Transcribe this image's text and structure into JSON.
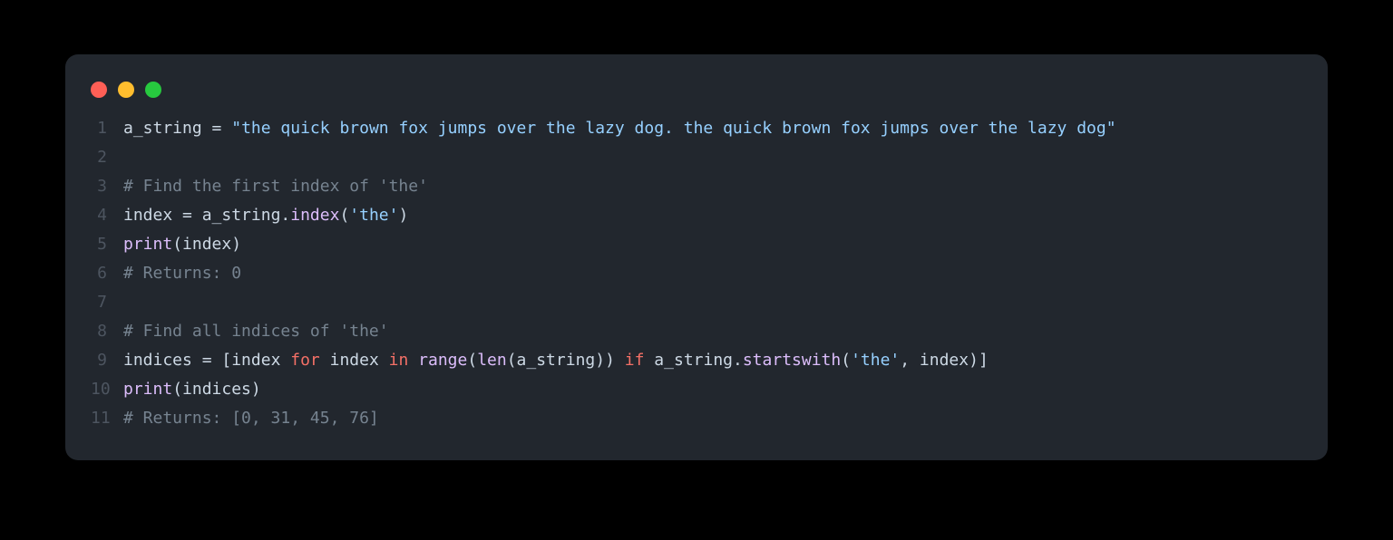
{
  "window": {
    "dots": [
      "red",
      "yellow",
      "green"
    ]
  },
  "code": {
    "lines": [
      {
        "n": "1",
        "tokens": [
          {
            "t": "a_string ",
            "c": "t-text"
          },
          {
            "t": "=",
            "c": "t-op"
          },
          {
            "t": " ",
            "c": "t-text"
          },
          {
            "t": "\"the quick brown fox jumps over the lazy dog. the quick brown fox jumps over the lazy dog\"",
            "c": "t-str"
          }
        ]
      },
      {
        "n": "2",
        "tokens": []
      },
      {
        "n": "3",
        "tokens": [
          {
            "t": "# Find the first index of 'the'",
            "c": "t-com"
          }
        ]
      },
      {
        "n": "4",
        "tokens": [
          {
            "t": "index ",
            "c": "t-text"
          },
          {
            "t": "=",
            "c": "t-op"
          },
          {
            "t": " a_string.",
            "c": "t-text"
          },
          {
            "t": "index",
            "c": "t-fn"
          },
          {
            "t": "(",
            "c": "t-paren"
          },
          {
            "t": "'the'",
            "c": "t-str"
          },
          {
            "t": ")",
            "c": "t-paren"
          }
        ]
      },
      {
        "n": "5",
        "tokens": [
          {
            "t": "print",
            "c": "t-fn"
          },
          {
            "t": "(",
            "c": "t-paren"
          },
          {
            "t": "index",
            "c": "t-text"
          },
          {
            "t": ")",
            "c": "t-paren"
          }
        ]
      },
      {
        "n": "6",
        "tokens": [
          {
            "t": "# Returns: 0",
            "c": "t-com"
          }
        ]
      },
      {
        "n": "7",
        "tokens": []
      },
      {
        "n": "8",
        "tokens": [
          {
            "t": "# Find all indices of 'the'",
            "c": "t-com"
          }
        ]
      },
      {
        "n": "9",
        "tokens": [
          {
            "t": "indices ",
            "c": "t-text"
          },
          {
            "t": "=",
            "c": "t-op"
          },
          {
            "t": " [index ",
            "c": "t-text"
          },
          {
            "t": "for",
            "c": "t-kw"
          },
          {
            "t": " index ",
            "c": "t-text"
          },
          {
            "t": "in",
            "c": "t-kw"
          },
          {
            "t": " ",
            "c": "t-text"
          },
          {
            "t": "range",
            "c": "t-fn"
          },
          {
            "t": "(",
            "c": "t-paren"
          },
          {
            "t": "len",
            "c": "t-fn"
          },
          {
            "t": "(",
            "c": "t-paren"
          },
          {
            "t": "a_string",
            "c": "t-text"
          },
          {
            "t": "))",
            "c": "t-paren"
          },
          {
            "t": " ",
            "c": "t-text"
          },
          {
            "t": "if",
            "c": "t-kw"
          },
          {
            "t": " a_string.",
            "c": "t-text"
          },
          {
            "t": "startswith",
            "c": "t-fn"
          },
          {
            "t": "(",
            "c": "t-paren"
          },
          {
            "t": "'the'",
            "c": "t-str"
          },
          {
            "t": ", index",
            "c": "t-text"
          },
          {
            "t": ")",
            "c": "t-paren"
          },
          {
            "t": "]",
            "c": "t-text"
          }
        ]
      },
      {
        "n": "10",
        "tokens": [
          {
            "t": "print",
            "c": "t-fn"
          },
          {
            "t": "(",
            "c": "t-paren"
          },
          {
            "t": "indices",
            "c": "t-text"
          },
          {
            "t": ")",
            "c": "t-paren"
          }
        ]
      },
      {
        "n": "11",
        "tokens": [
          {
            "t": "# Returns: [0, 31, 45, 76]",
            "c": "t-com"
          }
        ]
      }
    ]
  }
}
